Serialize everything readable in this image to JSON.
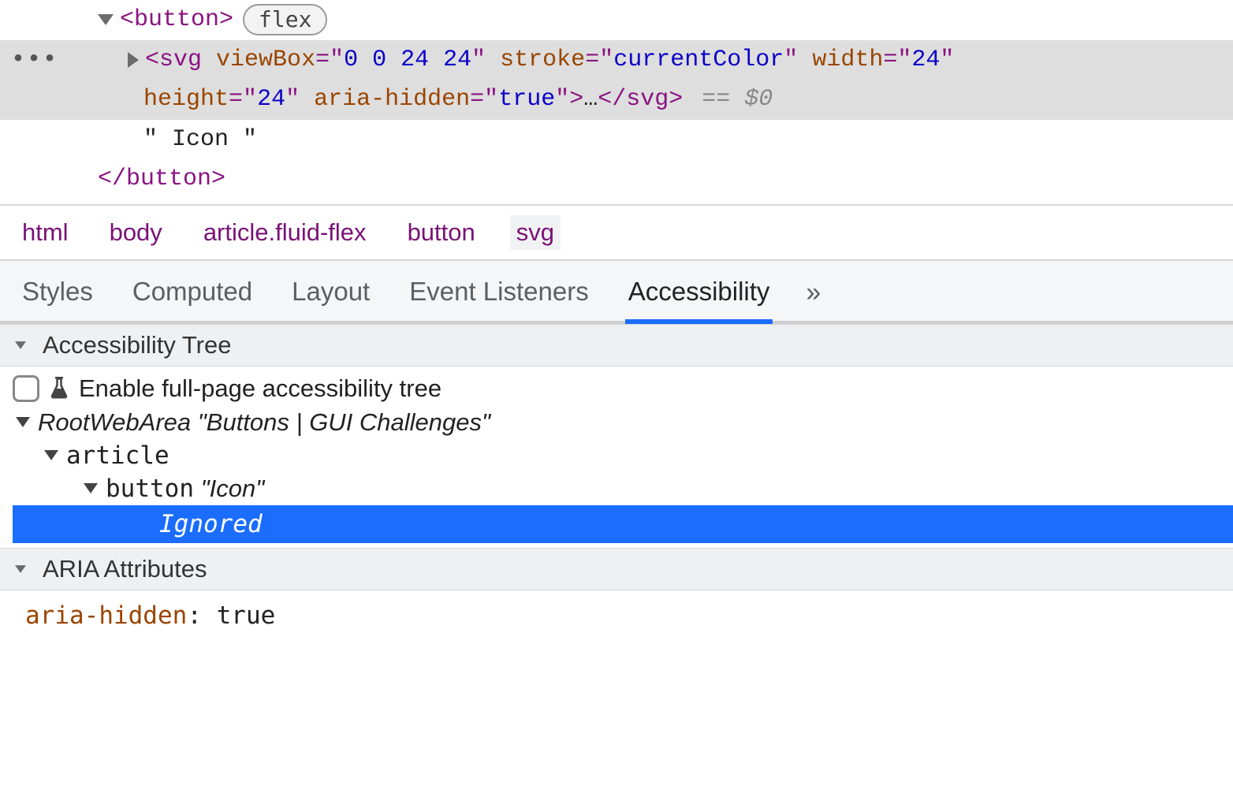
{
  "dom": {
    "button_open": "<button>",
    "flex_badge": "flex",
    "svg_tag": "svg",
    "svg_attrs": [
      {
        "name": "viewBox",
        "value": "0 0 24 24"
      },
      {
        "name": "stroke",
        "value": "currentColor"
      },
      {
        "name": "width",
        "value": "24"
      },
      {
        "name": "height",
        "value": "24"
      },
      {
        "name": "aria-hidden",
        "value": "true"
      }
    ],
    "svg_ellipsis": "…",
    "svg_close": "</svg>",
    "eq0": "== $0",
    "icon_text": "\" Icon \"",
    "button_close": "</button>",
    "gutter_dots": "•••"
  },
  "breadcrumb": [
    "html",
    "body",
    "article.fluid-flex",
    "button",
    "svg"
  ],
  "tabs": {
    "items": [
      "Styles",
      "Computed",
      "Layout",
      "Event Listeners",
      "Accessibility"
    ],
    "active_index": 4,
    "overflow_glyph": "»"
  },
  "ax": {
    "tree_header": "Accessibility Tree",
    "enable_label": "Enable full-page accessibility tree",
    "root_role": "RootWebArea",
    "root_name": "\"Buttons | GUI Challenges\"",
    "article_role": "article",
    "button_role": "button",
    "button_name": "\"Icon\"",
    "ignored_label": "Ignored",
    "aria_header": "ARIA Attributes",
    "aria_key": "aria-hidden",
    "aria_value": "true"
  }
}
